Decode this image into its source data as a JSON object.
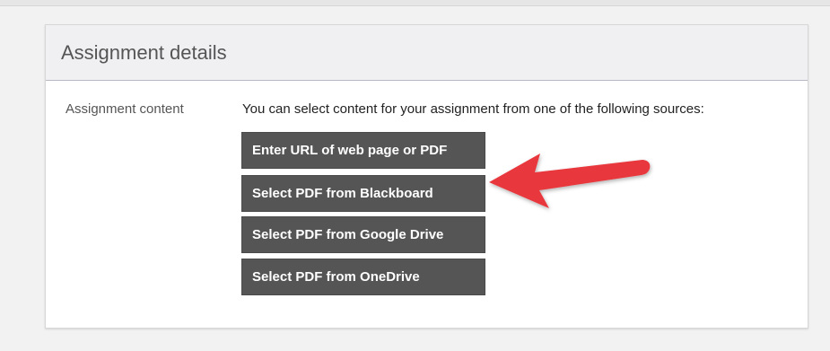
{
  "section": {
    "title": "Assignment details"
  },
  "assignment_content": {
    "label": "Assignment content",
    "description": "You can select content for your assignment from one of the following sources:",
    "buttons": [
      {
        "label": "Enter URL of web page or PDF"
      },
      {
        "label": "Select PDF from Blackboard"
      },
      {
        "label": "Select PDF from Google Drive"
      },
      {
        "label": "Select PDF from OneDrive"
      }
    ]
  },
  "colors": {
    "button_bg": "#555555",
    "arrow": "#e8383d",
    "header_bg": "#f0f0f3"
  },
  "icons": {
    "annotation": "red-arrow-icon"
  }
}
